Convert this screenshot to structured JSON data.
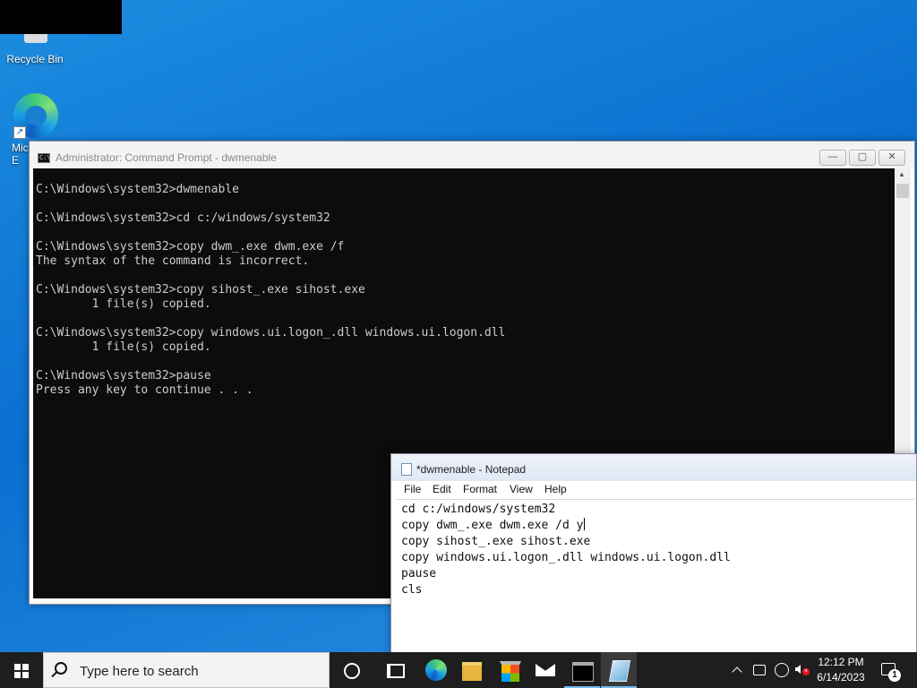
{
  "desktop": {
    "icons": [
      {
        "label": "Recycle Bin",
        "icon": "recycle-bin-icon"
      },
      {
        "label": "Mic\nE",
        "icon": "edge-icon"
      }
    ]
  },
  "cmd_window": {
    "title": "Administrator: Command Prompt - dwmenable",
    "icon": "cmd-icon",
    "controls": {
      "minimize": "—",
      "maximize": "▢",
      "close": "✕"
    },
    "output": "C:\\Windows\\system32>dwmenable\n\nC:\\Windows\\system32>cd c:/windows/system32\n\nC:\\Windows\\system32>copy dwm_.exe dwm.exe /f\nThe syntax of the command is incorrect.\n\nC:\\Windows\\system32>copy sihost_.exe sihost.exe\n        1 file(s) copied.\n\nC:\\Windows\\system32>copy windows.ui.logon_.dll windows.ui.logon.dll\n        1 file(s) copied.\n\nC:\\Windows\\system32>pause\nPress any key to continue . . ."
  },
  "notepad": {
    "title": "*dwmenable - Notepad",
    "icon": "notepad-icon",
    "menu": [
      "File",
      "Edit",
      "Format",
      "View",
      "Help"
    ],
    "text_before_caret": "cd c:/windows/system32\ncopy dwm_.exe dwm.exe /d y",
    "text_after_caret": "\ncopy sihost_.exe sihost.exe\ncopy windows.ui.logon_.dll windows.ui.logon.dll\npause\ncls"
  },
  "taskbar": {
    "search_placeholder": "Type here to search",
    "pinned": [
      "start-icon",
      "cortana-icon",
      "task-view-icon",
      "edge-icon",
      "file-explorer-icon",
      "store-icon",
      "mail-icon",
      "cmd-icon",
      "notepad-icon"
    ],
    "clock": {
      "time": "12:12 PM",
      "date": "6/14/2023"
    },
    "notification_count": "1"
  }
}
